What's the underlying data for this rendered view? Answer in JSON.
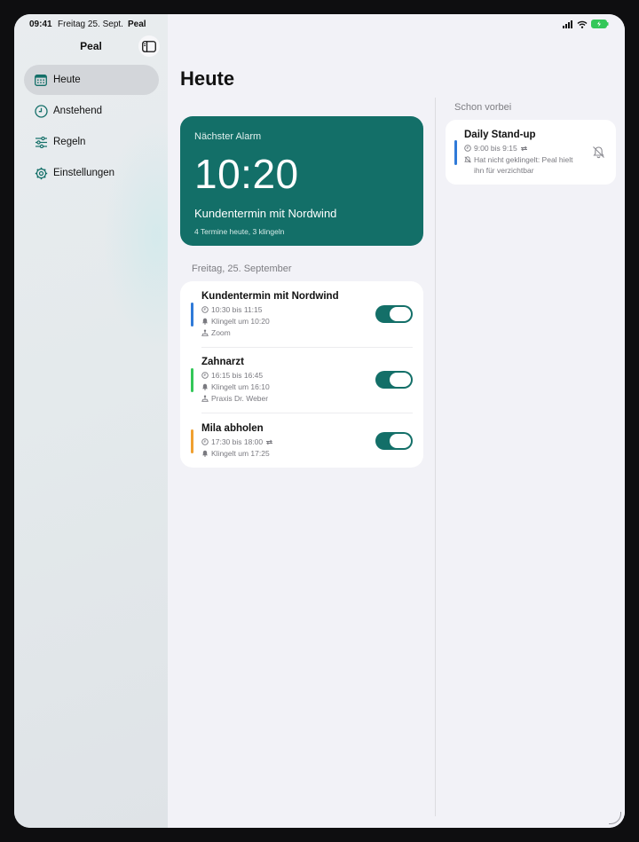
{
  "status_bar": {
    "time": "09:41",
    "date": "Freitag 25. Sept.",
    "app": "Peal"
  },
  "sidebar": {
    "title": "Peal",
    "items": [
      {
        "label": "Heute",
        "icon": "calendar-icon",
        "active": true
      },
      {
        "label": "Anstehend",
        "icon": "clock-icon",
        "active": false
      },
      {
        "label": "Regeln",
        "icon": "sliders-icon",
        "active": false
      },
      {
        "label": "Einstellungen",
        "icon": "gear-icon",
        "active": false
      }
    ]
  },
  "main": {
    "title": "Heute",
    "next_alarm": {
      "label": "Nächster Alarm",
      "time": "10:20",
      "title": "Kundentermin mit Nordwind",
      "summary": "4 Termine heute, 3 klingeln",
      "color": "#136f68"
    },
    "section_title": "Freitag, 25. September",
    "events": [
      {
        "title": "Kundentermin mit Nordwind",
        "time": "10:30 bis 11:15",
        "ring": "Klingelt um 10:20",
        "location": "Zoom",
        "color": "#2f7ad8",
        "enabled": true,
        "repeat": false
      },
      {
        "title": "Zahnarzt",
        "time": "16:15 bis 16:45",
        "ring": "Klingelt um 16:10",
        "location": "Praxis Dr. Weber",
        "color": "#34c759",
        "enabled": true,
        "repeat": false
      },
      {
        "title": "Mila abholen",
        "time": "17:30 bis 18:00",
        "ring": "Klingelt um 17:25",
        "color": "#f0a030",
        "enabled": true,
        "repeat": true
      }
    ],
    "past": {
      "title": "Schon vorbei",
      "event": {
        "title": "Daily Stand-up",
        "time": "9:00 bis 9:15",
        "note_line1": "Hat nicht geklingelt: Peal hielt",
        "note_line2": "ihn für verzichtbar",
        "color": "#2f7ad8",
        "repeat": true
      }
    }
  }
}
